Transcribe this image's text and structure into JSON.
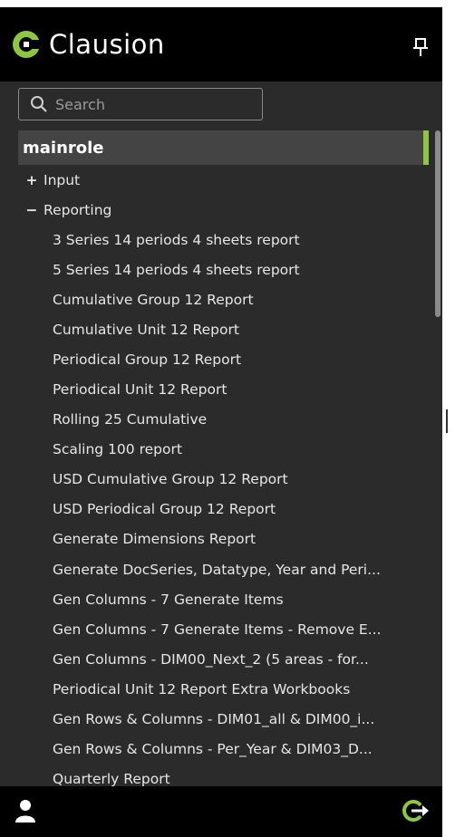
{
  "app": {
    "brand": "Clausion"
  },
  "colors": {
    "accent": "#8dc63f",
    "panel": "#2b2b2b",
    "topbar": "#000000",
    "selected": "#444444"
  },
  "search": {
    "placeholder": "Search",
    "value": ""
  },
  "role": {
    "label": "mainrole"
  },
  "folders": [
    {
      "sign": "+",
      "label": "Input",
      "expanded": false
    },
    {
      "sign": "−",
      "label": "Reporting",
      "expanded": true
    }
  ],
  "reports": [
    "3 Series 14 periods 4 sheets report",
    "5 Series 14 periods 4 sheets report",
    "Cumulative Group 12 Report",
    "Cumulative Unit 12 Report",
    "Periodical Group 12 Report",
    "Periodical Unit 12 Report",
    "Rolling 25 Cumulative",
    "Scaling 100 report",
    "USD Cumulative Group 12 Report",
    "USD Periodical Group 12 Report",
    "Generate Dimensions Report",
    "Generate DocSeries, Datatype, Year and Peri...",
    "Gen Columns - 7 Generate Items",
    "Gen Columns - 7 Generate Items - Remove E...",
    "Gen Columns - DIM00_Next_2 (5 areas - for...",
    "Periodical Unit 12 Report Extra Workbooks",
    "Gen Rows & Columns - DIM01_all & DIM00_i...",
    "Gen Rows & Columns - Per_Year & DIM03_D...",
    "Quarterly Report"
  ],
  "icons": {
    "pin": "pin-icon",
    "search": "search-icon",
    "user": "user-icon",
    "logout": "logout-icon"
  }
}
